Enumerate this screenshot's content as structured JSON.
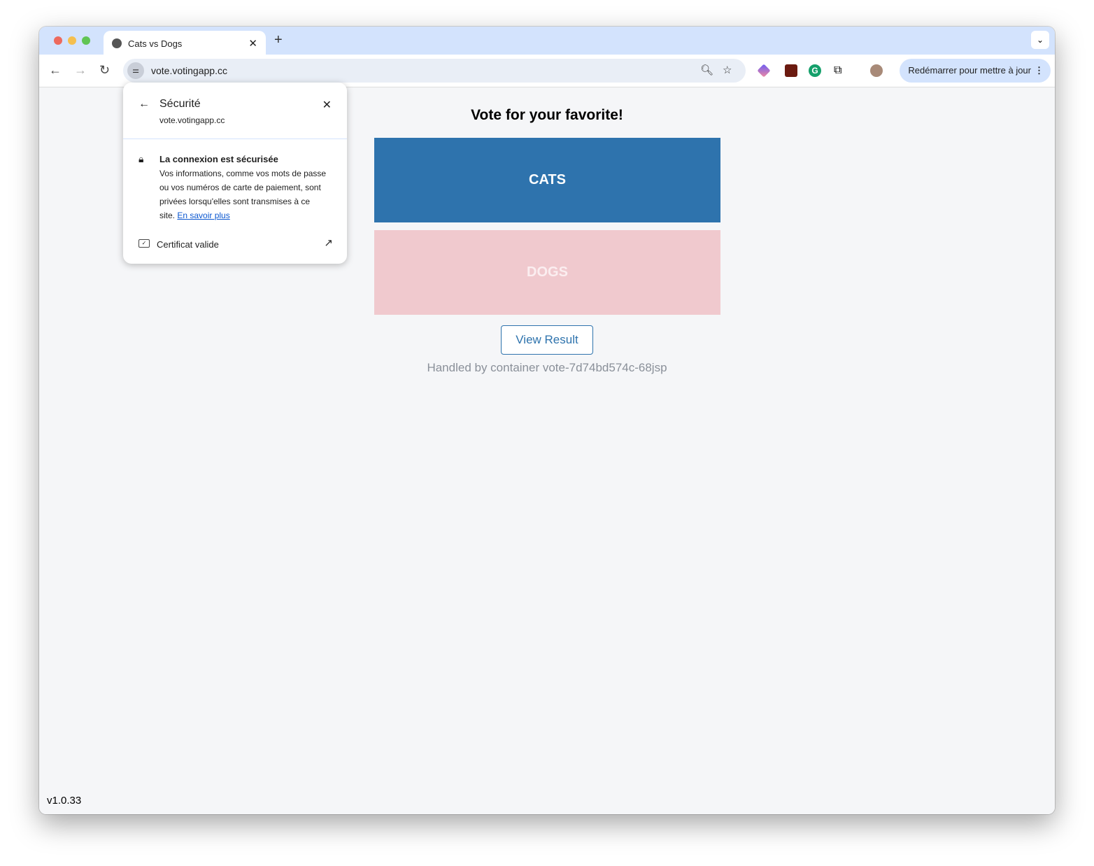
{
  "browser": {
    "tab_title": "Cats vs Dogs",
    "new_tab": "+",
    "url": "vote.votingapp.cc",
    "update_button": "Redémarrer pour mettre à jour"
  },
  "popup": {
    "title": "Sécurité",
    "domain": "vote.votingapp.cc",
    "connection_title": "La connexion est sécurisée",
    "connection_desc": "Vos informations, comme vos mots de passe ou vos numéros de carte de paiement, sont privées lorsqu'elles sont transmises à ce site.",
    "learn_more": "En savoir plus",
    "certificate": "Certificat valide"
  },
  "page": {
    "heading": "Vote for your favorite!",
    "option_a": "CATS",
    "option_b": "DOGS",
    "view_result": "View Result",
    "handled_by": "Handled by container vote-7d74bd574c-68jsp",
    "version": "v1.0.33"
  },
  "colors": {
    "cats": "#2e73ad",
    "dogs": "#f0c9ce",
    "tabbar": "#d3e3fd"
  }
}
